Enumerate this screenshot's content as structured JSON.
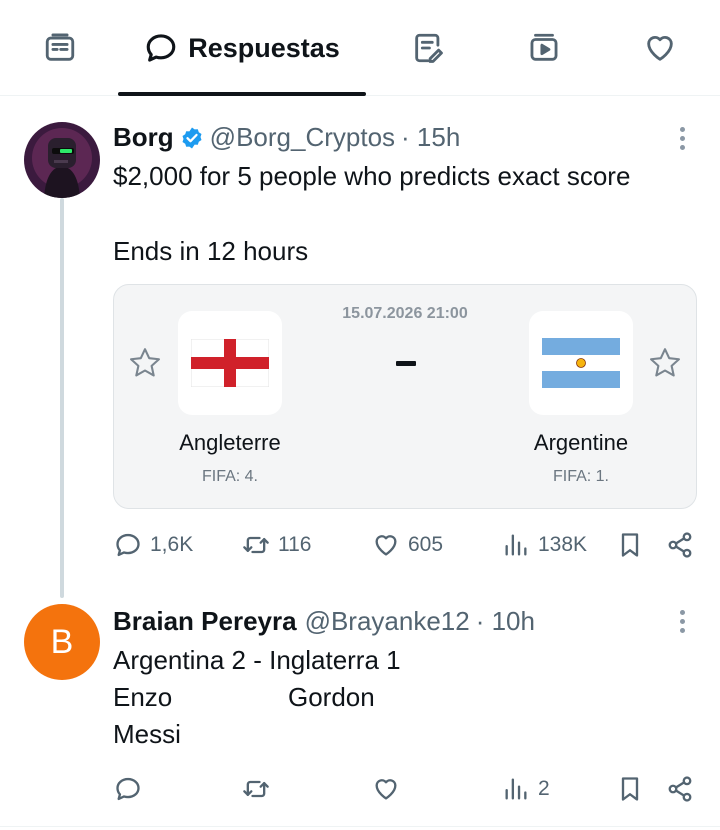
{
  "tabs": {
    "active_label": "Respuestas"
  },
  "post": {
    "author_name": "Borg",
    "author_handle": "@Borg_Cryptos",
    "time": "· 15h",
    "line1": "$2,000 for 5 people who predicts exact score",
    "line2": "Ends in 12 hours",
    "match": {
      "datetime": "15.07.2026 21:00",
      "home_team": "Angleterre",
      "home_rank": "FIFA: 4.",
      "away_team": "Argentine",
      "away_rank": "FIFA: 1."
    },
    "stats": {
      "replies": "1,6K",
      "reposts": "116",
      "likes": "605",
      "views": "138K"
    }
  },
  "reply": {
    "avatar_letter": "B",
    "author_name": "Braian Pereyra",
    "author_handle": "@Brayanke12",
    "time": "· 10h",
    "line1": "Argentina 2 - Inglaterra 1",
    "line2a": "Enzo",
    "line2b": "Gordon",
    "line3": "Messi",
    "stats": {
      "views": "2"
    }
  },
  "colors": {
    "verified": "#1d9bf0",
    "reply_avatar": "#f4730d",
    "muted": "#536471"
  }
}
